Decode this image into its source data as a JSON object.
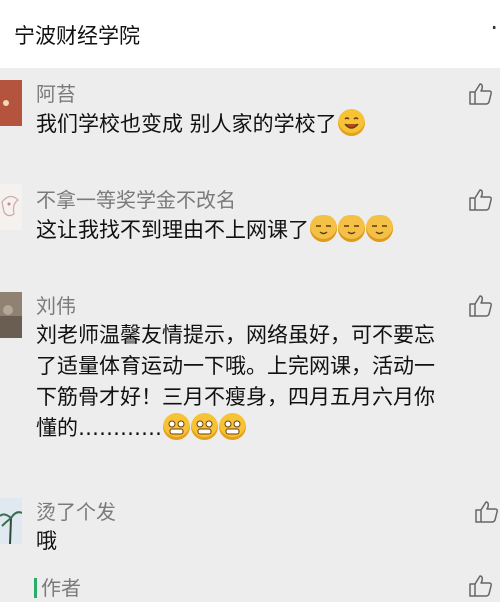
{
  "header": {
    "title": "宁波财经学院",
    "more": "·"
  },
  "comments": [
    {
      "name": "阿苔",
      "text": "我们学校也变成 别人家的学校了"
    },
    {
      "name": "不拿一等奖学金不改名",
      "text": "这让我找不到理由不上网课了"
    },
    {
      "name": "刘伟",
      "text_lines": [
        "刘老师温馨友情提示，网络虽好，可不要忘",
        "了适量体育运动一下哦。上完网课，活动一",
        "下筋骨才好！三月不瘦身，四月五月六月你",
        "懂的…………"
      ]
    },
    {
      "name": "烫了个发",
      "text": "哦"
    }
  ],
  "author_label": "作者",
  "icons": {
    "like": "thumbs-up-icon",
    "emoji_smile": "smiling-face-icon",
    "emoji_cat": "cat-face-icon",
    "emoji_grin": "grinning-face-icon"
  },
  "colors": {
    "background": "#ededed",
    "header_bg": "#ffffff",
    "name_text": "#7a7a7a",
    "author_bar": "#2aae67"
  }
}
